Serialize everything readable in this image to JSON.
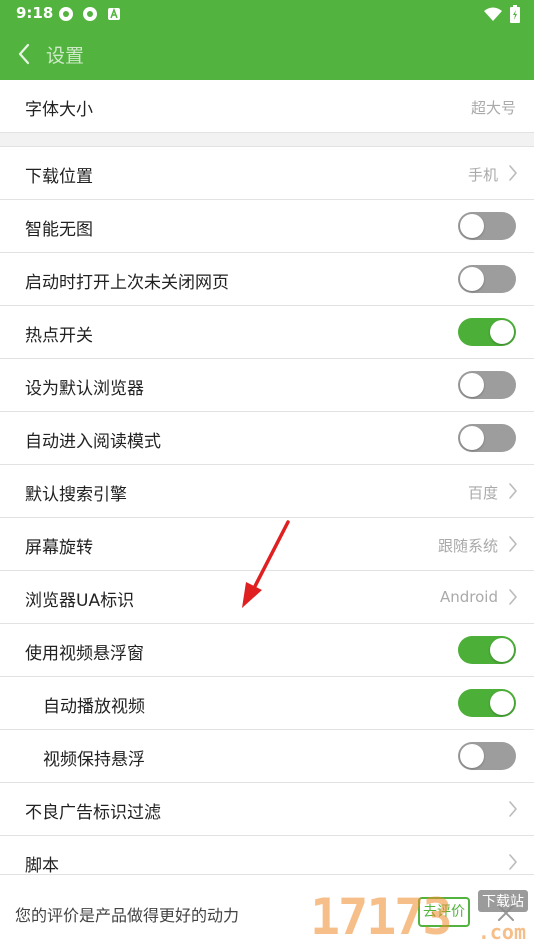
{
  "status_bar": {
    "time": "9:18",
    "icons": [
      "browser-notification-icon",
      "browser-notification-icon",
      "a-notification-icon",
      "wifi-icon",
      "battery-icon"
    ]
  },
  "app_bar": {
    "title": "设置",
    "back_icon": "back-arrow-icon"
  },
  "settings": {
    "font_size": {
      "label": "字体大小",
      "value": "超大号"
    },
    "items": [
      {
        "label": "下载位置",
        "value": "手机",
        "type": "link"
      },
      {
        "label": "智能无图",
        "type": "toggle",
        "on": false
      },
      {
        "label": "启动时打开上次未关闭网页",
        "type": "toggle",
        "on": false
      },
      {
        "label": "热点开关",
        "type": "toggle",
        "on": true
      },
      {
        "label": "设为默认浏览器",
        "type": "toggle",
        "on": false
      },
      {
        "label": "自动进入阅读模式",
        "type": "toggle",
        "on": false
      },
      {
        "label": "默认搜索引擎",
        "value": "百度",
        "type": "link"
      },
      {
        "label": "屏幕旋转",
        "value": "跟随系统",
        "type": "link"
      },
      {
        "label": "浏览器UA标识",
        "value": "Android",
        "type": "link"
      },
      {
        "label": "使用视频悬浮窗",
        "type": "toggle",
        "on": true
      },
      {
        "label": "自动播放视频",
        "type": "toggle",
        "on": true,
        "indent": true
      },
      {
        "label": "视频保持悬浮",
        "type": "toggle",
        "on": false,
        "indent": true
      },
      {
        "label": "不良广告标识过滤",
        "type": "link"
      },
      {
        "label": "脚本",
        "type": "link"
      }
    ]
  },
  "footer": {
    "text": "您的评价是产品做得更好的动力",
    "rate_button": "去评价",
    "close_icon": "close-icon"
  },
  "watermark": {
    "number": "17173",
    "tag": "下载站",
    "domain": ".com"
  },
  "colors": {
    "accent": "#52b33f",
    "toggle_on": "#4caf38",
    "toggle_off": "#9d9d9d",
    "annotation_arrow": "#e02020"
  }
}
